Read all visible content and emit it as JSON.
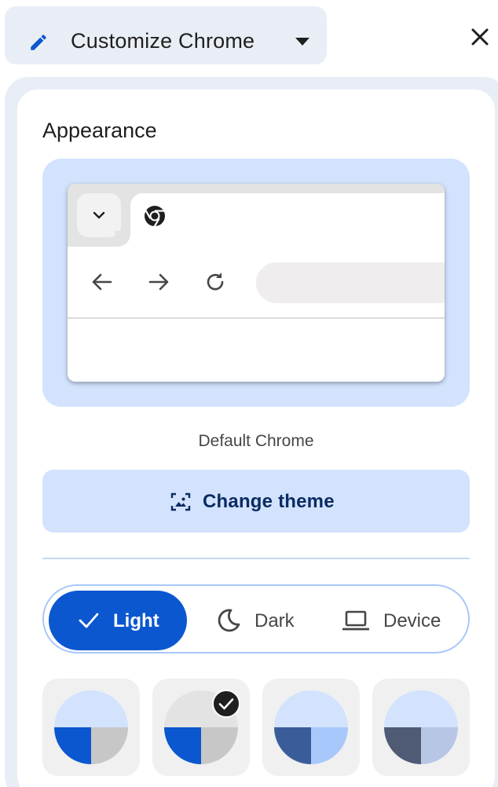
{
  "header": {
    "title": "Customize Chrome",
    "edit_icon": "pencil-icon",
    "dropdown_icon": "caret-down-icon",
    "close_icon": "close-icon"
  },
  "appearance": {
    "title": "Appearance",
    "theme_name": "Default Chrome",
    "change_theme_label": "Change theme",
    "change_theme_icon": "image-frame-icon"
  },
  "mode": {
    "options": [
      {
        "label": "Light",
        "icon": "check-icon",
        "selected": true
      },
      {
        "label": "Dark",
        "icon": "moon-icon",
        "selected": false
      },
      {
        "label": "Device",
        "icon": "laptop-icon",
        "selected": false
      }
    ]
  },
  "swatches": [
    {
      "top": "#d3e3fd",
      "left": "#0b57d0",
      "right": "#c7c7c7",
      "selected": false
    },
    {
      "top": "#e3e3e3",
      "left": "#0b57d0",
      "right": "#c7c7c7",
      "selected": true
    },
    {
      "top": "#d3e3fd",
      "left": "#3a5d9a",
      "right": "#a8c7fa",
      "selected": false
    },
    {
      "top": "#d3e3fd",
      "left": "#4f5b75",
      "right": "#b7c6e5",
      "selected": false
    }
  ],
  "colors": {
    "accent": "#0b57d0",
    "accent_soft": "#d3e3fd",
    "panel_bg": "#e9eef6"
  }
}
